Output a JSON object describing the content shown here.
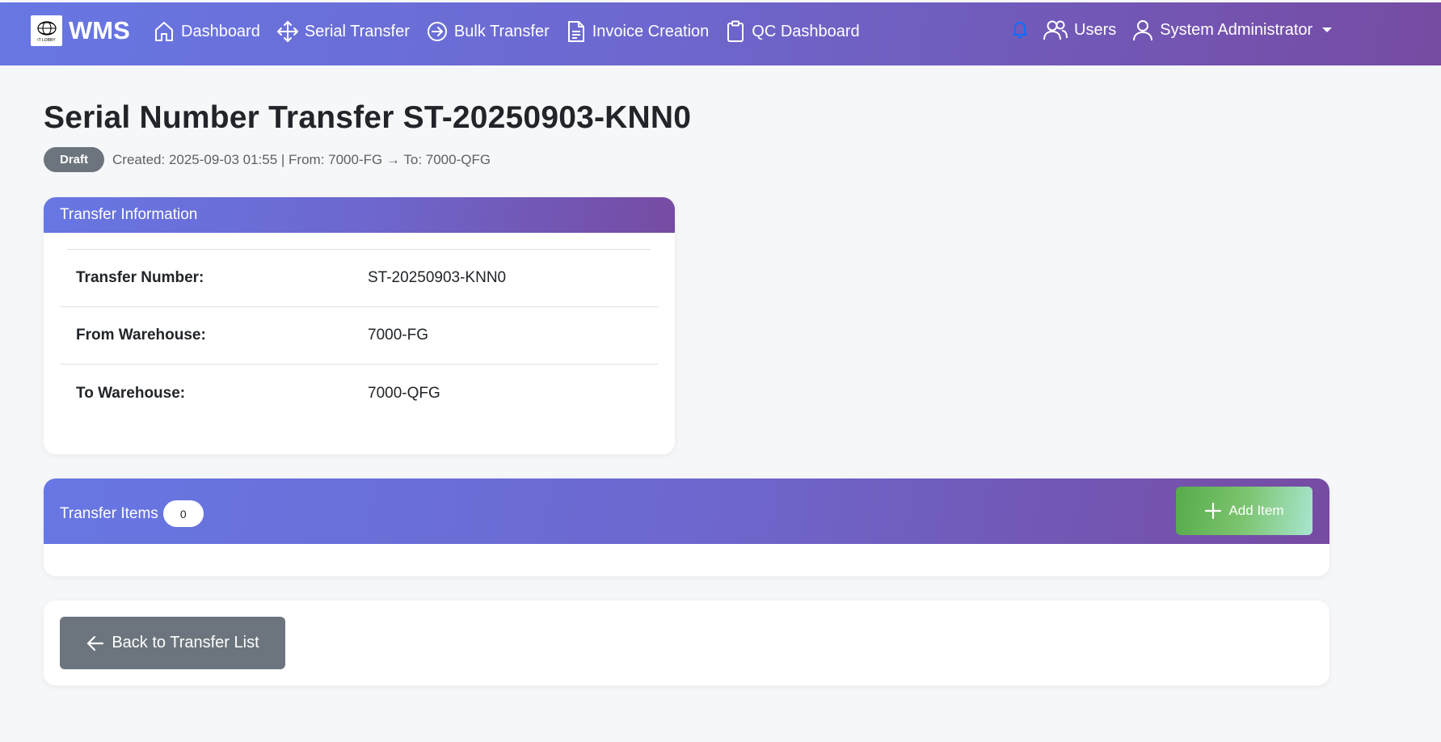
{
  "navbar": {
    "brand": "WMS",
    "logo_text": "IT LOBBY",
    "items": [
      {
        "label": "Dashboard",
        "icon": "house-icon"
      },
      {
        "label": "Serial Transfer",
        "icon": "arrows-move-icon"
      },
      {
        "label": "Bulk Transfer",
        "icon": "arrow-right-circle-icon"
      },
      {
        "label": "Invoice Creation",
        "icon": "file-text-icon"
      },
      {
        "label": "QC Dashboard",
        "icon": "clipboard-icon"
      }
    ],
    "users_label": "Users",
    "user_name": "System Administrator"
  },
  "page": {
    "title": "Serial Number Transfer ST-20250903-KNN0",
    "status_badge": "Draft",
    "meta": "Created: 2025-09-03 01:55 | From: 7000-FG → To: 7000-QFG"
  },
  "transfer_info": {
    "header": "Transfer Information",
    "rows": [
      {
        "label": "Transfer Number:",
        "value": "ST-20250903-KNN0"
      },
      {
        "label": "From Warehouse:",
        "value": "7000-FG"
      },
      {
        "label": "To Warehouse:",
        "value": "7000-QFG"
      }
    ]
  },
  "transfer_items": {
    "header": "Transfer Items",
    "count": "0",
    "add_button": "Add Item"
  },
  "actions": {
    "back_button": "Back to Transfer List"
  },
  "colors": {
    "header_gradient_start": "#6777e3",
    "header_gradient_end": "#764ba2",
    "badge": "#6c757d",
    "add_button": "#56ab4a",
    "bell": "#0d6efd"
  }
}
